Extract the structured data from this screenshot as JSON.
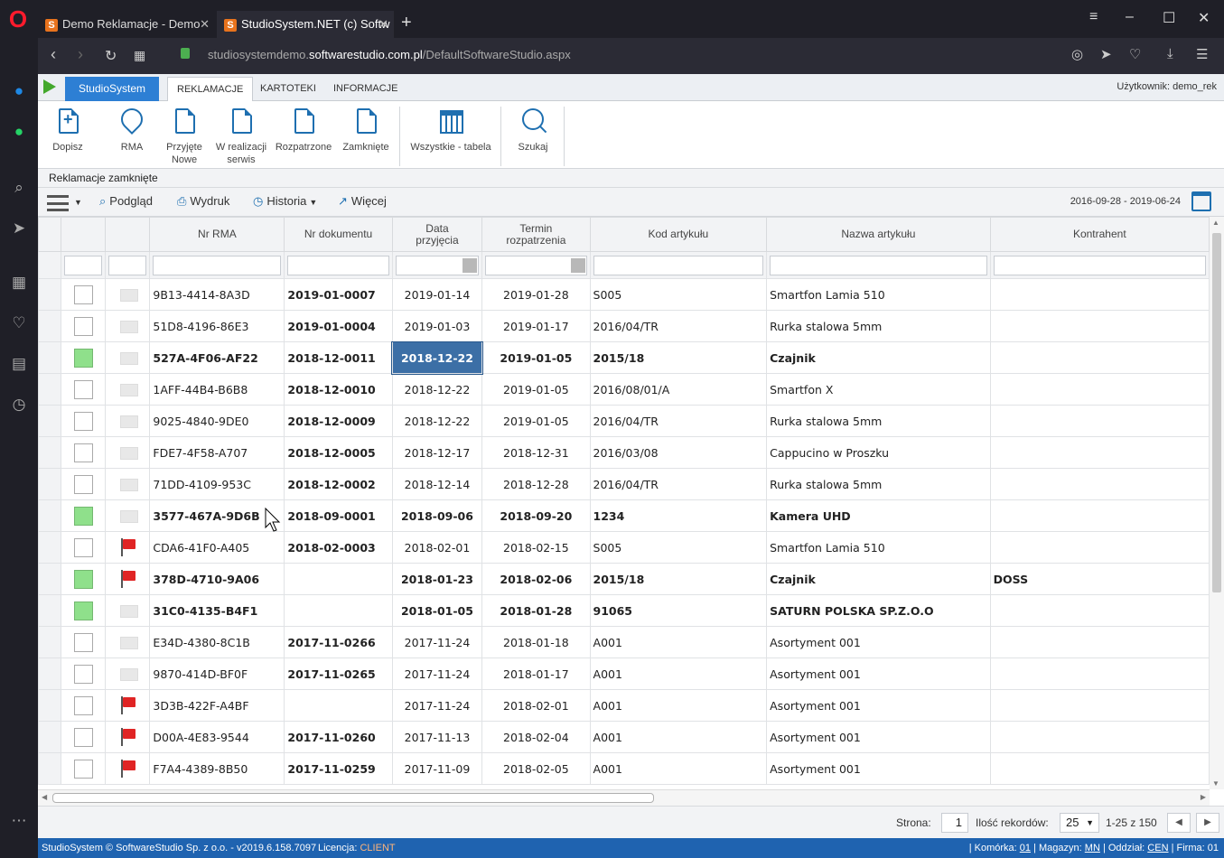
{
  "browser": {
    "tabs": [
      {
        "title": "Demo Reklamacje - Demo",
        "favicon": "S"
      },
      {
        "title": "StudioSystem.NET (c) Softw",
        "favicon": "S"
      }
    ],
    "url_prefix": "studiosystemdemo.",
    "url_domain": "softwarestudio.com.pl",
    "url_path": "/DefaultSoftwareStudio.aspx"
  },
  "app": {
    "brand_tab": "StudioSystem",
    "menu": [
      "REKLAMACJE",
      "KARTOTEKI",
      "INFORMACJE"
    ],
    "user": "Użytkownik: demo_rek"
  },
  "ribbon": {
    "buttons": [
      {
        "label": "Dopisz",
        "icon": "add-document-icon"
      },
      {
        "label": "RMA",
        "icon": "location-check-icon"
      },
      {
        "label": "Przyjęte Nowe",
        "icon": "edit-document-icon"
      },
      {
        "label": "W realizacji serwis",
        "icon": "document-icon"
      },
      {
        "label": "Rozpatrzone",
        "icon": "document-icon"
      },
      {
        "label": "Zamknięte",
        "icon": "document-icon"
      },
      {
        "label": "Wszystkie - tabela",
        "icon": "table-calendar-icon"
      },
      {
        "label": "Szukaj",
        "icon": "search-icon"
      }
    ]
  },
  "section_title": "Reklamacje zamknięte",
  "toolbar": {
    "podglad": "Podgląd",
    "wydruk": "Wydruk",
    "historia": "Historia",
    "wiecej": "Więcej",
    "date_range": "2016-09-28 - 2019-06-24"
  },
  "grid": {
    "columns": [
      "Nr RMA",
      "Nr dokumentu",
      "Data przyjęcia",
      "Termin rozpatrzenia",
      "Kod artykułu",
      "Nazwa artykułu",
      "Kontrahent"
    ],
    "rows": [
      {
        "checked": false,
        "flag": false,
        "bold": false,
        "rma": "9B13-4414-8A3D",
        "doc": "2019-01-0007",
        "data": "2019-01-14",
        "termin": "2019-01-28",
        "kod": "S005",
        "nazwa": "Smartfon Lamia 510",
        "kontrahent": ""
      },
      {
        "checked": false,
        "flag": false,
        "bold": false,
        "rma": "51D8-4196-86E3",
        "doc": "2019-01-0004",
        "data": "2019-01-03",
        "termin": "2019-01-17",
        "kod": "2016/04/TR",
        "nazwa": "Rurka stalowa 5mm",
        "kontrahent": ""
      },
      {
        "checked": true,
        "flag": false,
        "bold": true,
        "rma": "527A-4F06-AF22",
        "doc": "2018-12-0011",
        "data": "2018-12-22",
        "termin": "2019-01-05",
        "kod": "2015/18",
        "nazwa": "Czajnik",
        "kontrahent": ""
      },
      {
        "checked": false,
        "flag": false,
        "bold": false,
        "rma": "1AFF-44B4-B6B8",
        "doc": "2018-12-0010",
        "data": "2018-12-22",
        "termin": "2019-01-05",
        "kod": "2016/08/01/A",
        "nazwa": "Smartfon X",
        "kontrahent": ""
      },
      {
        "checked": false,
        "flag": false,
        "bold": false,
        "rma": "9025-4840-9DE0",
        "doc": "2018-12-0009",
        "data": "2018-12-22",
        "termin": "2019-01-05",
        "kod": "2016/04/TR",
        "nazwa": "Rurka stalowa 5mm",
        "kontrahent": ""
      },
      {
        "checked": false,
        "flag": false,
        "bold": false,
        "rma": "FDE7-4F58-A707",
        "doc": "2018-12-0005",
        "data": "2018-12-17",
        "termin": "2018-12-31",
        "kod": "2016/03/08",
        "nazwa": "Cappucino w Proszku",
        "kontrahent": ""
      },
      {
        "checked": false,
        "flag": false,
        "bold": false,
        "rma": "71DD-4109-953C",
        "doc": "2018-12-0002",
        "data": "2018-12-14",
        "termin": "2018-12-28",
        "kod": "2016/04/TR",
        "nazwa": "Rurka stalowa 5mm",
        "kontrahent": ""
      },
      {
        "checked": true,
        "flag": false,
        "bold": true,
        "rma": "3577-467A-9D6B",
        "doc": "2018-09-0001",
        "data": "2018-09-06",
        "termin": "2018-09-20",
        "kod": "1234",
        "nazwa": "Kamera UHD",
        "kontrahent": ""
      },
      {
        "checked": false,
        "flag": true,
        "bold": false,
        "rma": "CDA6-41F0-A405",
        "doc": "2018-02-0003",
        "data": "2018-02-01",
        "termin": "2018-02-15",
        "kod": "S005",
        "nazwa": "Smartfon Lamia 510",
        "kontrahent": ""
      },
      {
        "checked": true,
        "flag": true,
        "bold": true,
        "rma": "378D-4710-9A06",
        "doc": "",
        "data": "2018-01-23",
        "termin": "2018-02-06",
        "kod": "2015/18",
        "nazwa": "Czajnik",
        "kontrahent": "DOSS"
      },
      {
        "checked": true,
        "flag": false,
        "bold": true,
        "rma": "31C0-4135-B4F1",
        "doc": "",
        "data": "2018-01-05",
        "termin": "2018-01-28",
        "kod": "91065",
        "nazwa": "SATURN POLSKA SP.Z.O.O",
        "kontrahent": ""
      },
      {
        "checked": false,
        "flag": false,
        "bold": false,
        "rma": "E34D-4380-8C1B",
        "doc": "2017-11-0266",
        "data": "2017-11-24",
        "termin": "2018-01-18",
        "kod": "A001",
        "nazwa": "Asortyment 001",
        "kontrahent": ""
      },
      {
        "checked": false,
        "flag": false,
        "bold": false,
        "rma": "9870-414D-BF0F",
        "doc": "2017-11-0265",
        "data": "2017-11-24",
        "termin": "2018-01-17",
        "kod": "A001",
        "nazwa": "Asortyment 001",
        "kontrahent": ""
      },
      {
        "checked": false,
        "flag": true,
        "bold": false,
        "rma": "3D3B-422F-A4BF",
        "doc": "",
        "data": "2017-11-24",
        "termin": "2018-02-01",
        "kod": "A001",
        "nazwa": "Asortyment 001",
        "kontrahent": ""
      },
      {
        "checked": false,
        "flag": true,
        "bold": false,
        "rma": "D00A-4E83-9544",
        "doc": "2017-11-0260",
        "data": "2017-11-13",
        "termin": "2018-02-04",
        "kod": "A001",
        "nazwa": "Asortyment 001",
        "kontrahent": ""
      },
      {
        "checked": false,
        "flag": true,
        "bold": false,
        "rma": "F7A4-4389-8B50",
        "doc": "2017-11-0259",
        "data": "2017-11-09",
        "termin": "2018-02-05",
        "kod": "A001",
        "nazwa": "Asortyment 001",
        "kontrahent": ""
      }
    ],
    "selected_cell": {
      "row": 2,
      "col": "data"
    }
  },
  "pager": {
    "strona_label": "Strona:",
    "strona_value": "1",
    "ilosc_label": "Ilość rekordów:",
    "ilosc_value": "25",
    "range": "1-25 z 150"
  },
  "status": {
    "copyright": "StudioSystem © SoftwareStudio Sp. z o.o. - v2019.6.158.7097",
    "licencja_label": "Licencja:",
    "licencja_value": "CLIENT",
    "komorka_label": "Komórka:",
    "komorka_value": "01",
    "magazyn_label": "Magazyn:",
    "magazyn_value": "MN",
    "oddzial_label": "Oddział:",
    "oddzial_value": "CEN",
    "firma_label": "Firma:",
    "firma_value": "01"
  },
  "colors": {
    "accent": "#2d7fd4",
    "status_bar": "#1f63b0",
    "checked": "#8fe08b",
    "selected_cell": "#3c6fa6",
    "flag": "#e02424"
  }
}
